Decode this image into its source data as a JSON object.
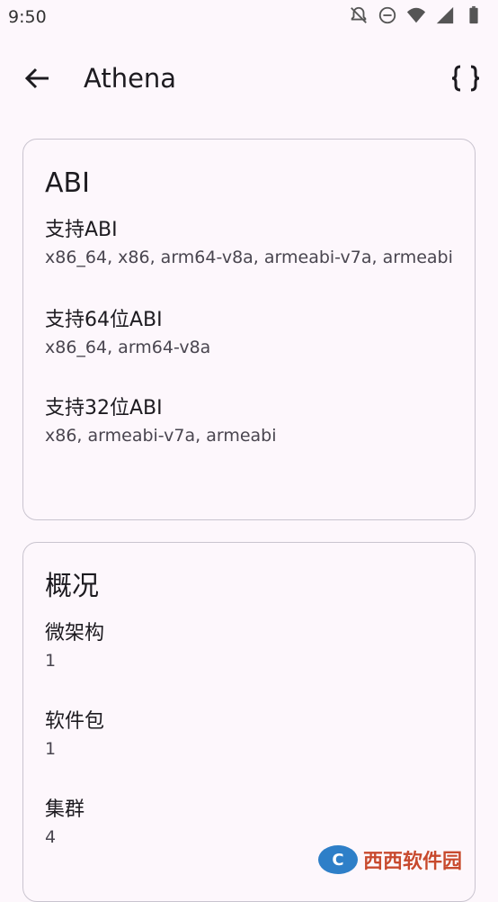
{
  "status_bar": {
    "time": "9:50",
    "icons": [
      "bell-off-icon",
      "dnd-icon",
      "wifi-icon",
      "signal-icon",
      "battery-icon"
    ]
  },
  "app_bar": {
    "title": "Athena",
    "back_icon": "arrow-left-icon",
    "action_icon": "code-braces-icon"
  },
  "abi_card": {
    "title": "ABI",
    "items": [
      {
        "label": "支持ABI",
        "value": "x86_64, x86, arm64-v8a, armeabi-v7a, armeabi"
      },
      {
        "label": "支持64位ABI",
        "value": "x86_64, arm64-v8a"
      },
      {
        "label": "支持32位ABI",
        "value": "x86, armeabi-v7a, armeabi"
      }
    ]
  },
  "overview_card": {
    "title": "概况",
    "items": [
      {
        "label": "微架构",
        "value": "1"
      },
      {
        "label": "软件包",
        "value": "1"
      },
      {
        "label": "集群",
        "value": "4"
      }
    ]
  },
  "watermark": {
    "text": "西西软件园"
  }
}
